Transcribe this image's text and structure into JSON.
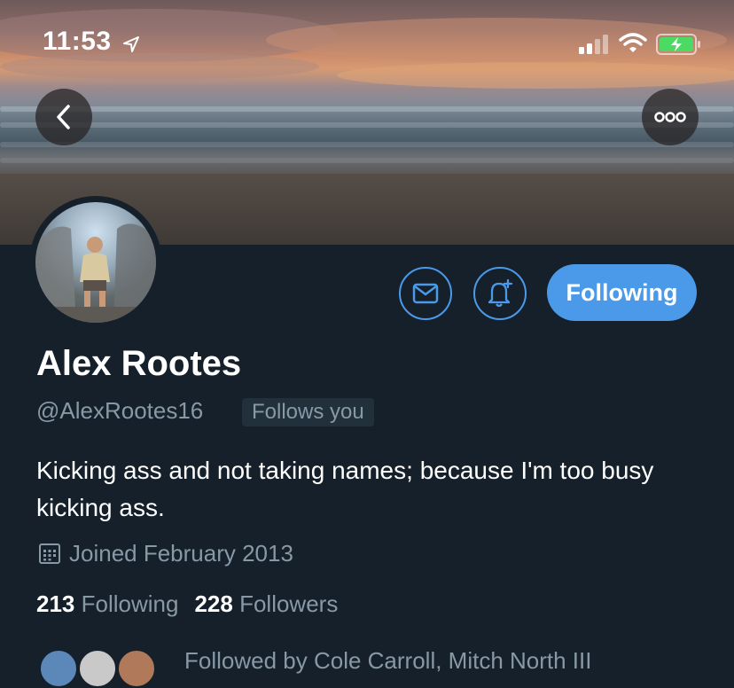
{
  "status_bar": {
    "time": "11:53",
    "icons": [
      "location-arrow-icon",
      "cellular-signal-icon",
      "wifi-icon",
      "battery-charging-icon"
    ]
  },
  "banner": {
    "nav_icons": [
      "chevron-left-icon",
      "more-dots-icon"
    ]
  },
  "profile": {
    "name": "Alex Rootes",
    "handle": "@AlexRootes16",
    "follows_you": "Follows you",
    "bio": "Kicking ass and not taking names; because I'm too busy kicking ass.",
    "joined": "Joined February 2013",
    "following_count": "213",
    "following_label": "Following",
    "followers_count": "228",
    "followers_label": "Followers",
    "followed_by": "Followed by Cole Carroll, Mitch North III"
  },
  "actions": {
    "following_button": "Following",
    "icons": [
      "envelope-icon",
      "bell-plus-icon"
    ]
  },
  "colors": {
    "background": "#15202b",
    "accent": "#4a9ae9",
    "secondary_text": "#8899a6",
    "battery": "#4cd964"
  }
}
